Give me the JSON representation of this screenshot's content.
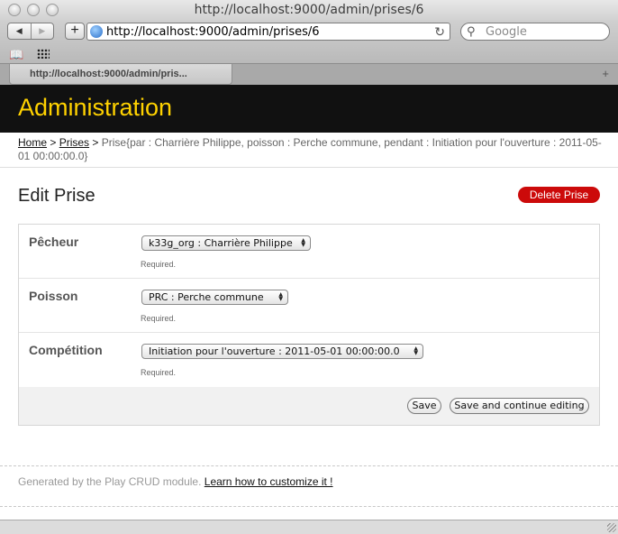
{
  "browser": {
    "window_title": "http://localhost:9000/admin/prises/6",
    "url": "http://localhost:9000/admin/prises/6",
    "search_placeholder": "Google",
    "tab_title": "http://localhost:9000/admin/pris..."
  },
  "header": {
    "title": "Administration"
  },
  "breadcrumb": {
    "home": "Home",
    "sep1": ">",
    "prises": "Prises",
    "sep2": ">",
    "current": "Prise{par : Charrière Philippe, poisson : Perche commune, pendant : Initiation pour l'ouverture : 2011-05-01 00:00:00.0}"
  },
  "page": {
    "title": "Edit Prise",
    "delete_label": "Delete Prise"
  },
  "form": {
    "fields": [
      {
        "label": "Pêcheur",
        "value": "k33g_org : Charrière Philippe",
        "hint": "Required."
      },
      {
        "label": "Poisson",
        "value": "PRC : Perche commune",
        "hint": "Required."
      },
      {
        "label": "Compétition",
        "value": "Initiation pour l'ouverture : 2011-05-01 00:00:00.0",
        "hint": "Required."
      }
    ],
    "save_label": "Save",
    "save_continue_label": "Save and continue editing"
  },
  "footer": {
    "text": "Generated by the Play CRUD module.",
    "link": "Learn how to customize it !"
  },
  "colors": {
    "header_bg": "#111111",
    "header_title": "#ffd200",
    "delete_button": "#cc0a0a"
  }
}
